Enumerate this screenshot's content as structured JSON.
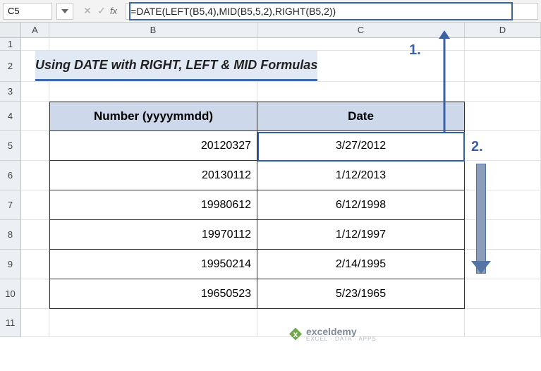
{
  "nameBox": "C5",
  "formula": "=DATE(LEFT(B5,4),MID(B5,5,2),RIGHT(B5,2))",
  "fxLabel": "fx",
  "columns": [
    "A",
    "B",
    "C",
    "D"
  ],
  "rows": [
    "1",
    "2",
    "3",
    "4",
    "5",
    "6",
    "7",
    "8",
    "9",
    "10",
    "11"
  ],
  "title": "Using DATE with RIGHT, LEFT & MID Formulas",
  "headers": {
    "col1": "Number (yyyymmdd)",
    "col2": "Date"
  },
  "table": [
    {
      "num": "20120327",
      "date": "3/27/2012"
    },
    {
      "num": "20130112",
      "date": "1/12/2013"
    },
    {
      "num": "19980612",
      "date": "6/12/1998"
    },
    {
      "num": "19970112",
      "date": "1/12/1997"
    },
    {
      "num": "19950214",
      "date": "2/14/1995"
    },
    {
      "num": "19650523",
      "date": "5/23/1965"
    }
  ],
  "annotations": {
    "step1": "1.",
    "step2": "2."
  },
  "watermark": {
    "brand": "exceldemy",
    "tag": "EXCEL · DATA · APPS"
  }
}
